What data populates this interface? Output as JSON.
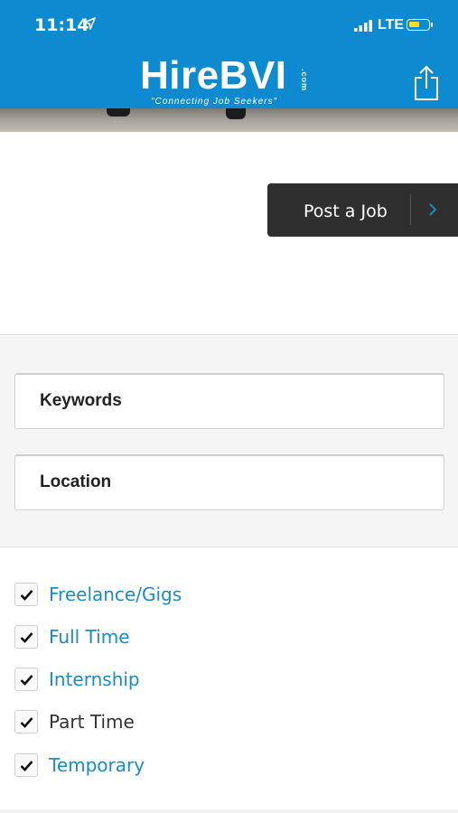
{
  "status_bar": {
    "time": "11:14",
    "network": "LTE",
    "icons": [
      "location-arrow-icon",
      "signal-icon",
      "battery-icon"
    ],
    "battery_color": "#ffdc19"
  },
  "header": {
    "logo": "HireBVI",
    "logo_suffix": ".com",
    "tagline": "\"Connecting Job Seekers\"",
    "share_icon": "share-icon",
    "background": "#0e8bd0"
  },
  "post_job": {
    "label": "Post a Job",
    "icon": "chevron-right-icon"
  },
  "search": {
    "keywords_label": "Keywords",
    "location_label": "Location"
  },
  "filters": [
    {
      "label": "Freelance/Gigs",
      "checked": true,
      "color": "#1a8bc6"
    },
    {
      "label": "Full Time",
      "checked": true,
      "color": "#1a8bc6"
    },
    {
      "label": "Internship",
      "checked": true,
      "color": "#1a8bc6"
    },
    {
      "label": "Part Time",
      "checked": true,
      "color": "#333333"
    },
    {
      "label": "Temporary",
      "checked": true,
      "color": "#1a8bc6"
    }
  ],
  "colors": {
    "accent": "#0e8bd0",
    "link": "#1a8bc6",
    "dark_button": "#2f2f2f"
  }
}
